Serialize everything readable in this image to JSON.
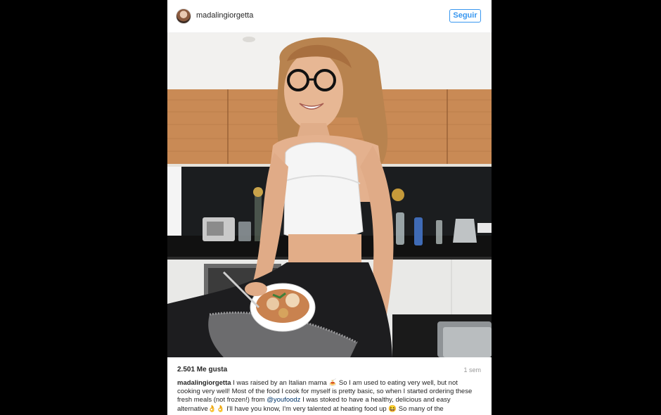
{
  "header": {
    "username": "madalingiorgetta",
    "follow_label": "Seguir"
  },
  "photo": {
    "description_icon": "post-photo"
  },
  "footer": {
    "likes": "2.501 Me gusta",
    "time": "1 sem"
  },
  "caption": {
    "username": "madalingiorgetta",
    "text_part1": " I was raised by an Italian mama 🍝 So I am used to eating very well, but not cooking very well! Most of the food I cook for myself is pretty basic, so when I started ordering these fresh meals (not frozen!) from ",
    "mention": "@youfoodz",
    "text_part2": " I was stoked to have a healthy, delicious and easy alternative👌👌 I'll have you know, I'm very talented at heating food up 😆 So many of the"
  },
  "colors": {
    "background": "#000000",
    "accent": "#3897f0",
    "text": "#262626",
    "muted": "#999999"
  }
}
